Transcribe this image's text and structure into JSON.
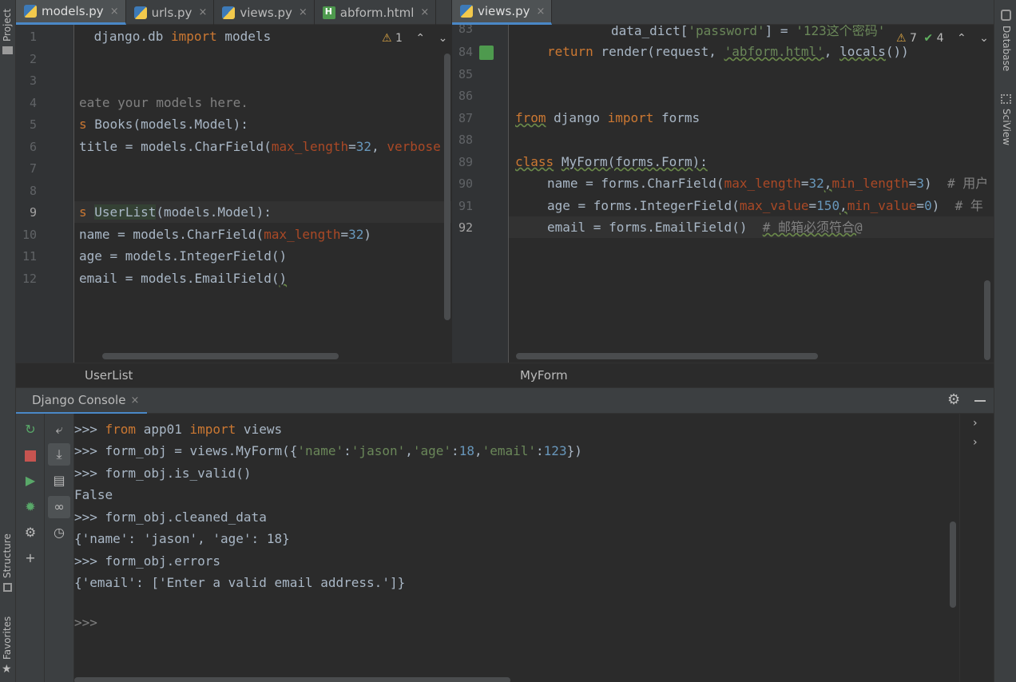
{
  "left_strip": {
    "top_label": "Project",
    "structure_label": "Structure",
    "favorites_label": "Favorites"
  },
  "right_strip": {
    "database_label": "Database",
    "sciview_label": "SciView"
  },
  "left_tabs": [
    {
      "label": "models.py",
      "icon": "python-file-icon",
      "active": true
    },
    {
      "label": "urls.py",
      "icon": "python-file-icon",
      "active": false
    },
    {
      "label": "views.py",
      "icon": "python-file-icon",
      "active": false
    },
    {
      "label": "abform.html",
      "icon": "html-file-icon",
      "active": false
    }
  ],
  "right_tabs": [
    {
      "label": "views.py",
      "icon": "python-file-icon",
      "active": true
    }
  ],
  "tab_close_glyph": "×",
  "left_editor": {
    "inspection": {
      "warnings": "1"
    },
    "line_numbers": [
      "1",
      "2",
      "3",
      "4",
      "5",
      "6",
      "7",
      "8",
      "9",
      "10",
      "11",
      "12"
    ],
    "breadcrumb": "UserList"
  },
  "right_editor": {
    "inspection": {
      "warnings": "7",
      "checks": "4"
    },
    "line_numbers": [
      "83",
      "84",
      "85",
      "86",
      "87",
      "88",
      "89",
      "90",
      "91",
      "92"
    ],
    "breadcrumb": "MyForm"
  },
  "console": {
    "tab_label": "Django Console",
    "lines": [
      ">>> from app01 import views",
      ">>> form_obj = views.MyForm({'name':'jason','age':18,'email':123})",
      ">>> form_obj.is_valid()",
      "False",
      ">>> form_obj.cleaned_data",
      "{'name': 'jason', 'age': 18}",
      ">>> form_obj.errors",
      "{'email': ['Enter a valid email address.']}",
      "",
      ">>>"
    ]
  },
  "colors": {
    "background": "#2b2b2b",
    "panel": "#3c3f41",
    "keyword": "#cc7832",
    "string": "#6a8759",
    "number": "#6897bb",
    "accent": "#4a88c7"
  }
}
